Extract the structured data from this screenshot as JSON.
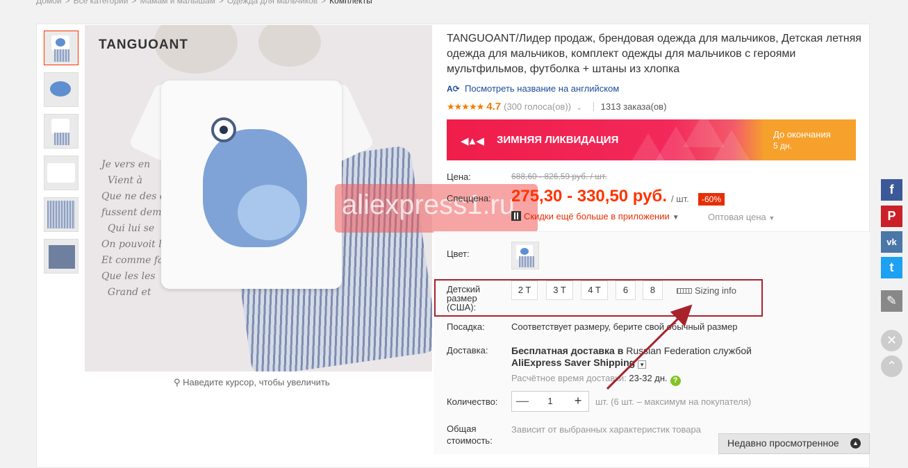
{
  "breadcrumb": {
    "items": [
      "Домой",
      "Все категории",
      "Мамам и малышам",
      "Одежда для мальчиков",
      "Комплекты"
    ]
  },
  "product": {
    "title": "TANGUOANT/Лидер продаж, брендовая одежда для мальчиков, Детская летняя одежда для мальчиков, комплект одежды для мальчиков с героями мультфильмов, футболка + штаны из хлопка",
    "view_english": "Посмотреть название на английском",
    "rating_stars": "★★★★★",
    "rating": "4.7",
    "votes": "(300 голоса(ов))",
    "orders": "1313 заказа(ов)",
    "image_brand": "TANGUOANT",
    "image_script": "Je vers en\n  Vient à\nQue ne des et\nfussent demande\n  Qui lui se\nOn pouvoit le\nEt comme fa\nQue les les\n  Grand et",
    "zoom_hint": "Наведите курсор, чтобы увеличить",
    "watermark": "aliexpress1.ru"
  },
  "banner": {
    "title": "ЗИМНЯЯ ЛИКВИДАЦИЯ",
    "countdown_label": "До окончания",
    "countdown_value": "5 дн.",
    "colors": {
      "primary": "#ef1d4a",
      "accent": "#f8a628"
    }
  },
  "price": {
    "label": "Цена:",
    "old": "688,60 - 826,59 руб. / шт.",
    "special_label": "Спеццена:",
    "new": "275,30 - 330,50 руб.",
    "per_unit": "/ шт.",
    "discount": "-60%",
    "app_deal": "Скидки ещё больше в приложении",
    "wholesale": "Оптовая цена",
    "accent_color": "#ff3300"
  },
  "options": {
    "color_label": "Цвет:",
    "size_label": "Детский размер (США):",
    "sizes": [
      "2 T",
      "3 T",
      "4 T",
      "6",
      "8"
    ],
    "sizing_info": "Sizing info",
    "fit_label": "Посадка:",
    "fit_value": "Соответствует размеру, берите свой обычный размер"
  },
  "shipping": {
    "label": "Доставка:",
    "line1_bold": "Бесплатная доставка в ",
    "line1_country": "Russian Federation",
    "line1_end": " службой",
    "line2": "AliExpress Saver Shipping",
    "eta_label": "Расчётное время доставки: ",
    "eta_value": "23-32 дн."
  },
  "quantity": {
    "label": "Количество:",
    "value": "1",
    "minus": "—",
    "plus": "+",
    "note": "шт. (6 шт. – максимум на покупателя)"
  },
  "total": {
    "label": "Общая стоимость:",
    "value": "Зависит от выбранных характеристик товара"
  },
  "recent": {
    "label": "Недавно просмотренное"
  },
  "social": {
    "colors": {
      "facebook": "#3b5998",
      "pinterest": "#cb2027",
      "vk": "#4a76a8",
      "twitter": "#1da1f2",
      "edit": "#888888"
    },
    "icons": [
      "facebook-icon",
      "pinterest-icon",
      "vk-icon",
      "twitter-icon",
      "pencil-icon"
    ]
  },
  "annotation": {
    "color": "#a8222c"
  }
}
